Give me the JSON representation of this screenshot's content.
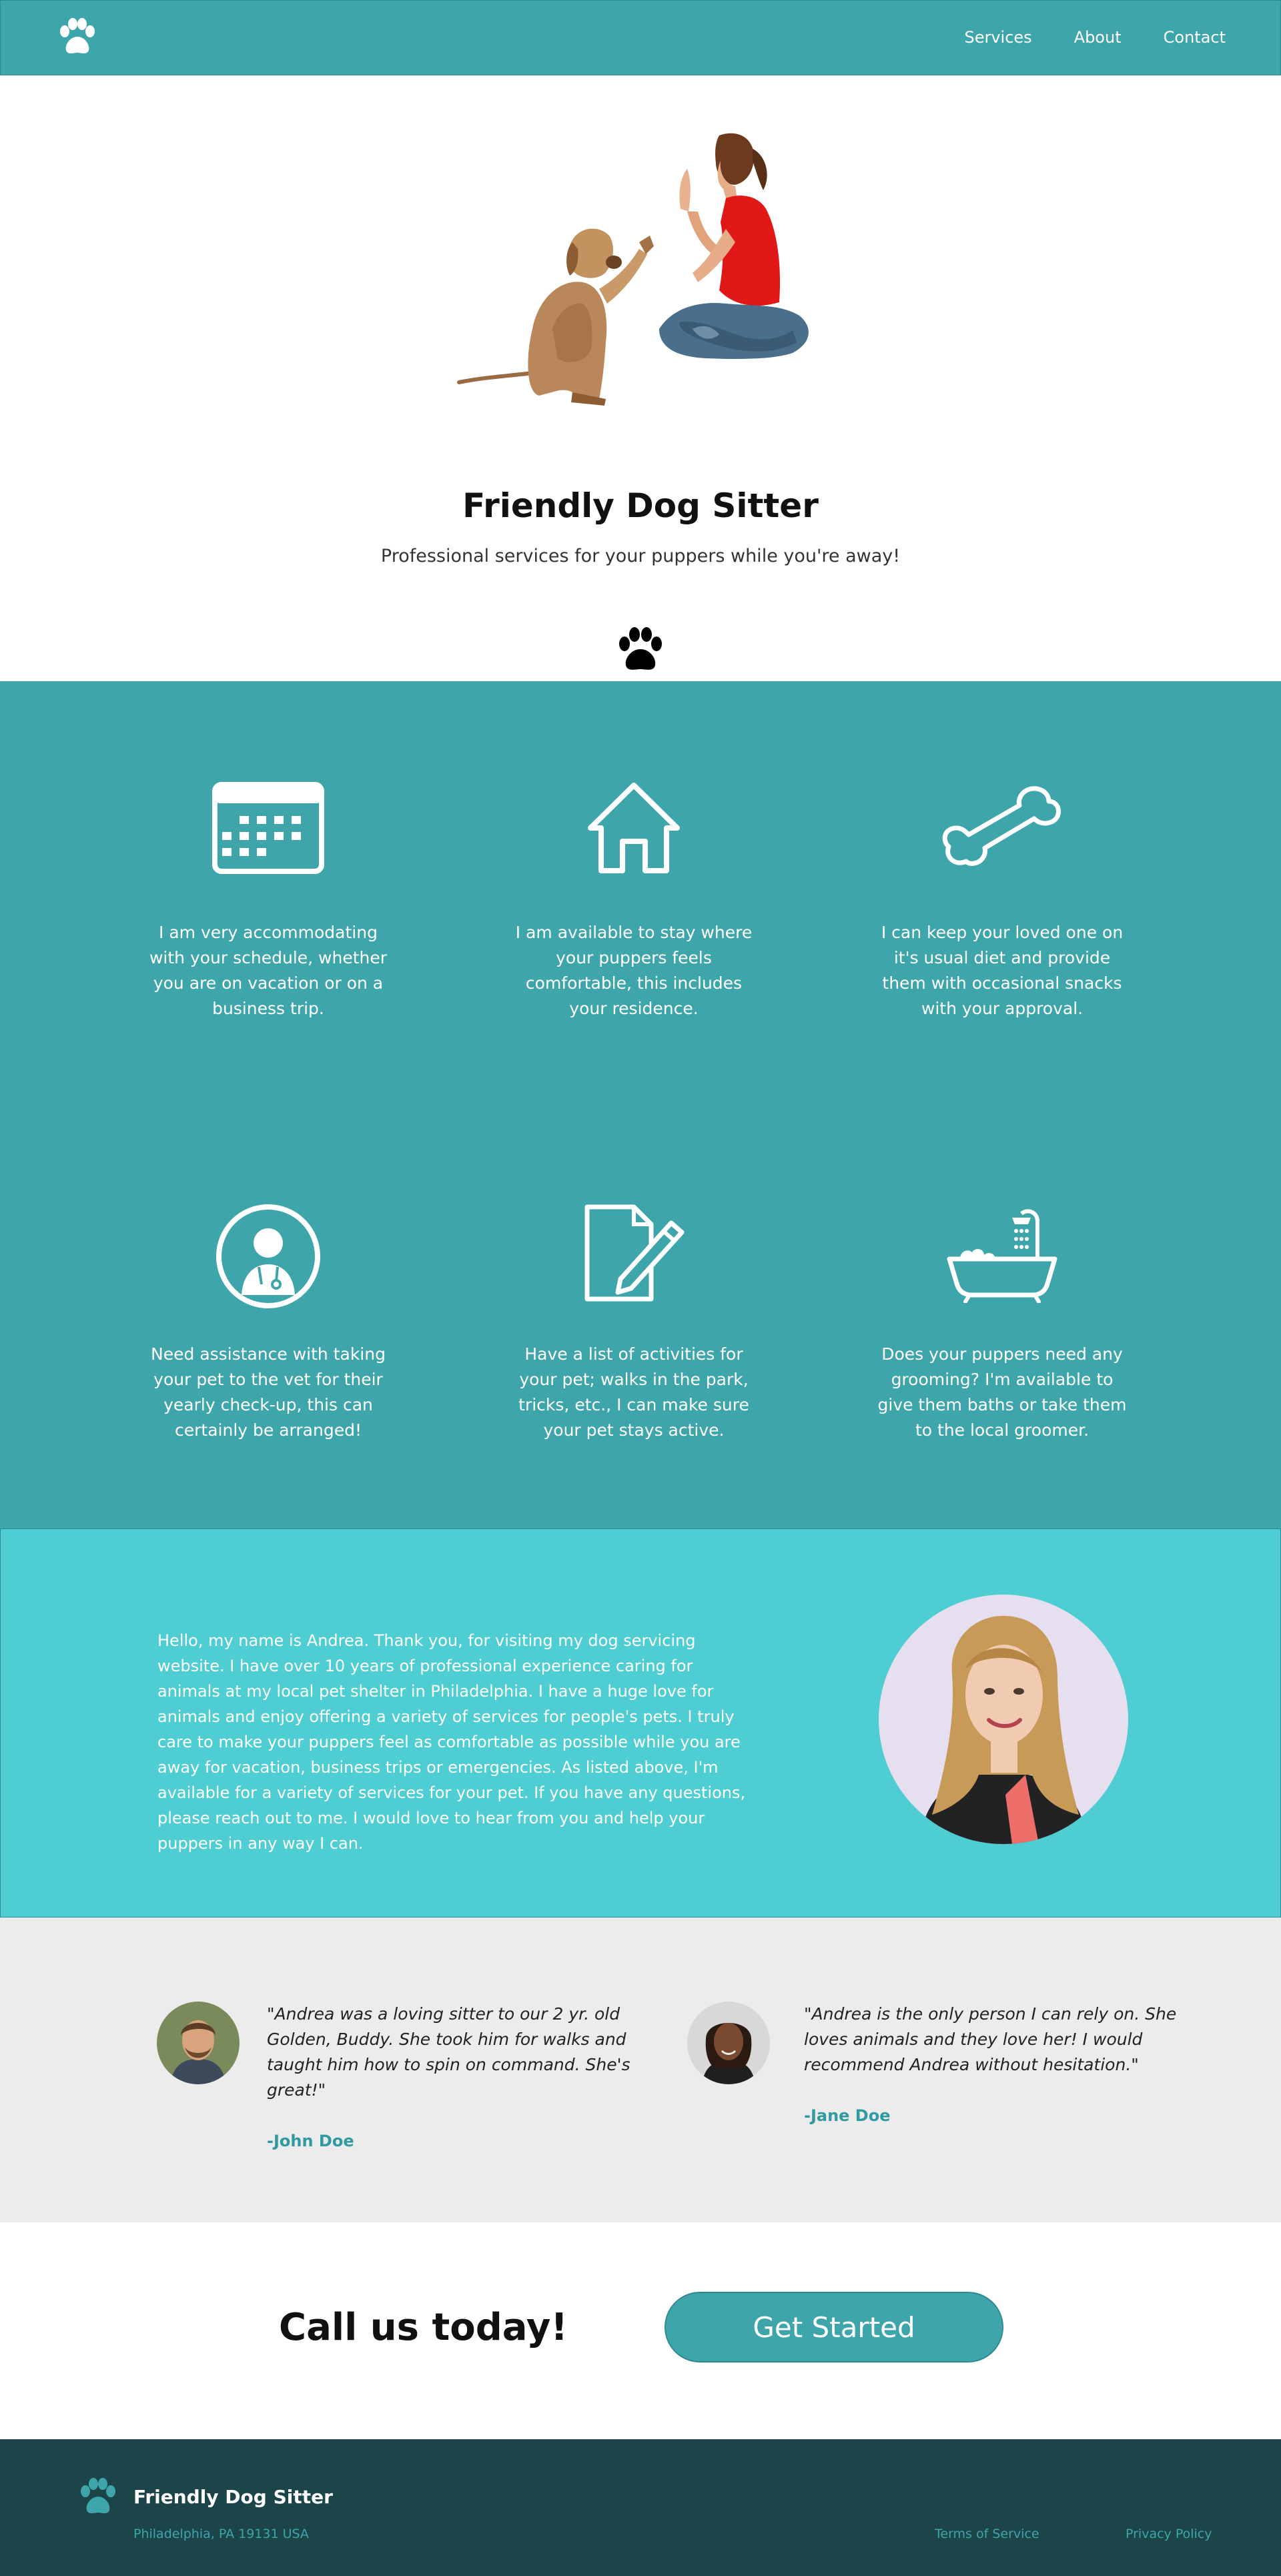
{
  "nav": {
    "logo_icon": "paw-icon",
    "links": [
      {
        "label": "Services"
      },
      {
        "label": "About"
      },
      {
        "label": "Contact"
      }
    ]
  },
  "hero": {
    "image_icon": "dog-high-five-illustration",
    "title": "Friendly Dog Sitter",
    "tagline": "Professional services for your puppers while you're away!",
    "paw_icon": "paw-icon"
  },
  "services": [
    {
      "icon": "calendar-icon",
      "text": "I am very accommodating with your schedule, whether you are on vacation or on a business trip."
    },
    {
      "icon": "house-icon",
      "text": "I am available to stay where your puppers feels comfortable, this includes your residence."
    },
    {
      "icon": "bone-icon",
      "text": "I can keep your loved one on it's usual diet and provide them with occasional snacks with your approval."
    },
    {
      "icon": "veterinarian-icon",
      "text": "Need assistance with taking your pet to the vet for their yearly check-up, this can certainly be arranged!"
    },
    {
      "icon": "note-pencil-icon",
      "text": "Have a list of activities for your pet; walks in the park, tricks, etc., I can make sure your pet stays active."
    },
    {
      "icon": "bathtub-icon",
      "text": "Does your puppers need any grooming? I'm available to give them baths or take them to the local groomer."
    }
  ],
  "about": {
    "text": "Hello, my name is Andrea. Thank you, for visiting my dog servicing website. I have over 10 years of professional experience caring for animals at my local pet shelter in Philadelphia. I have a huge love for animals and enjoy offering a variety of services for people's pets. I truly care to make your puppers feel as comfortable as possible while you are away for vacation, business trips or emergencies. As listed above, I'm available for a variety of services for your pet. If you have any questions, please reach out to me. I would love to hear from you and help your puppers in any way I can."
  },
  "testimonials": [
    {
      "quote": "\"Andrea was a loving sitter to our 2 yr. old Golden, Buddy. She took him for walks and taught him how to spin on command. She's great!\"",
      "author": "-John Doe"
    },
    {
      "quote": "\"Andrea is the only person I can rely on. She loves animals and they love her! I would recommend Andrea without hesitation.\"",
      "author": "-Jane Doe"
    }
  ],
  "cta": {
    "heading": "Call us today!",
    "button": "Get Started"
  },
  "footer": {
    "name": "Friendly Dog Sitter",
    "address": "Philadelphia, PA 19131 USA",
    "links": [
      {
        "label": "Terms of Service"
      },
      {
        "label": "Privacy Policy"
      }
    ]
  },
  "colors": {
    "primary": "#3ea5aa",
    "about_bg": "#4ecdd2",
    "testimonial_bg": "#ececec",
    "footer_bg": "#1b4548"
  }
}
